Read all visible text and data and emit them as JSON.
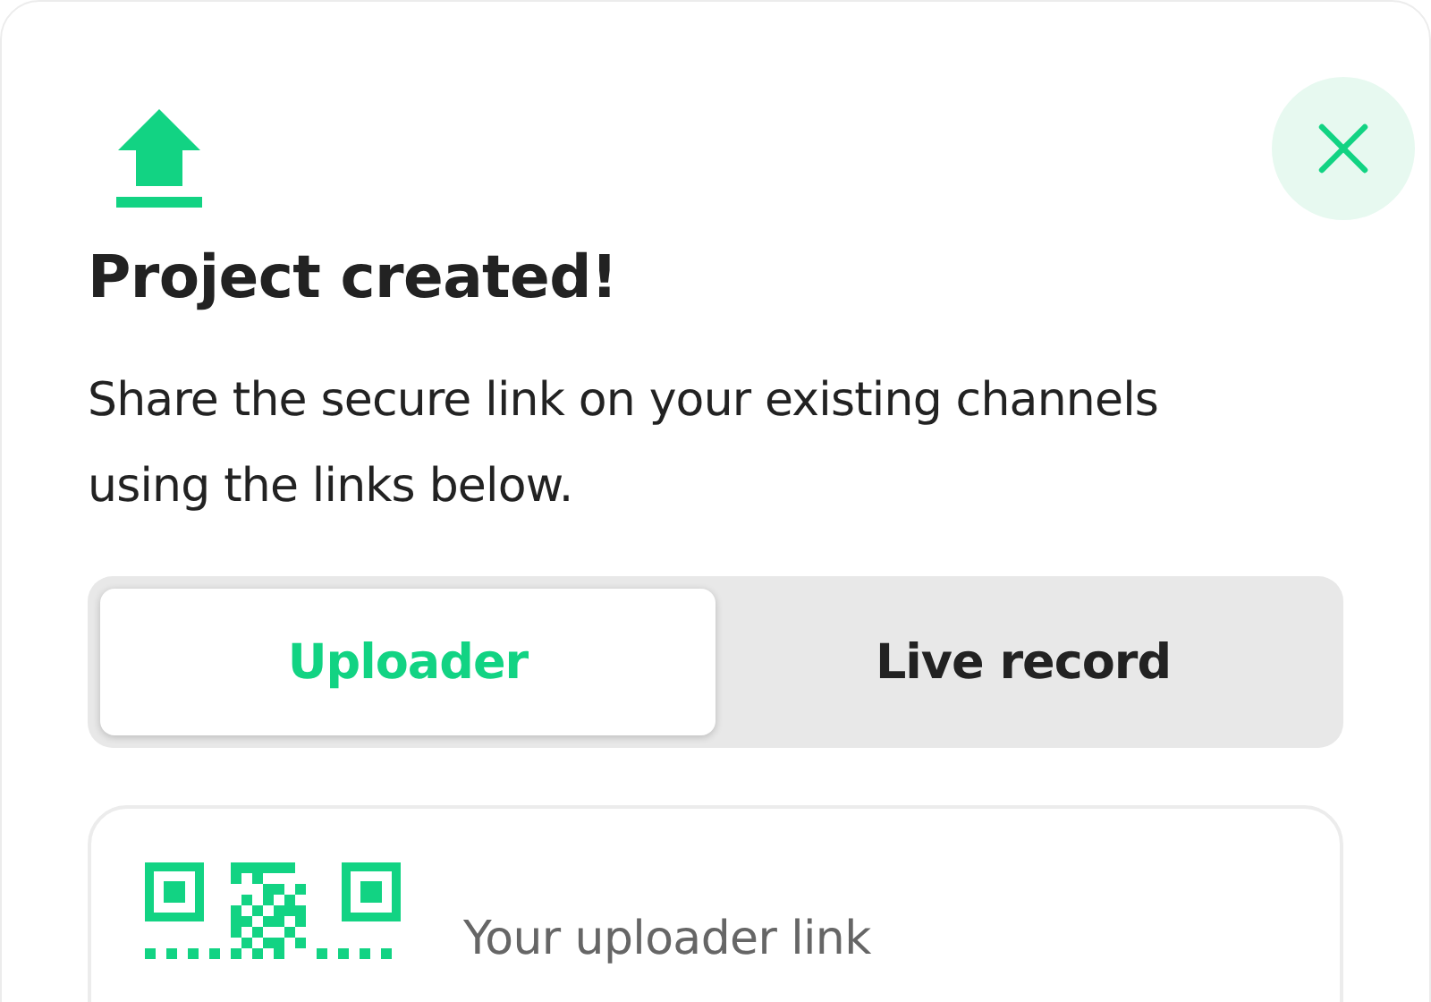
{
  "dialog": {
    "title": "Project created!",
    "message": "Share the secure link on your existing channels using the links below."
  },
  "tabs": [
    {
      "label": "Uploader",
      "selected": true
    },
    {
      "label": "Live record",
      "selected": false
    }
  ],
  "link_card": {
    "label": "Your uploader link"
  }
}
